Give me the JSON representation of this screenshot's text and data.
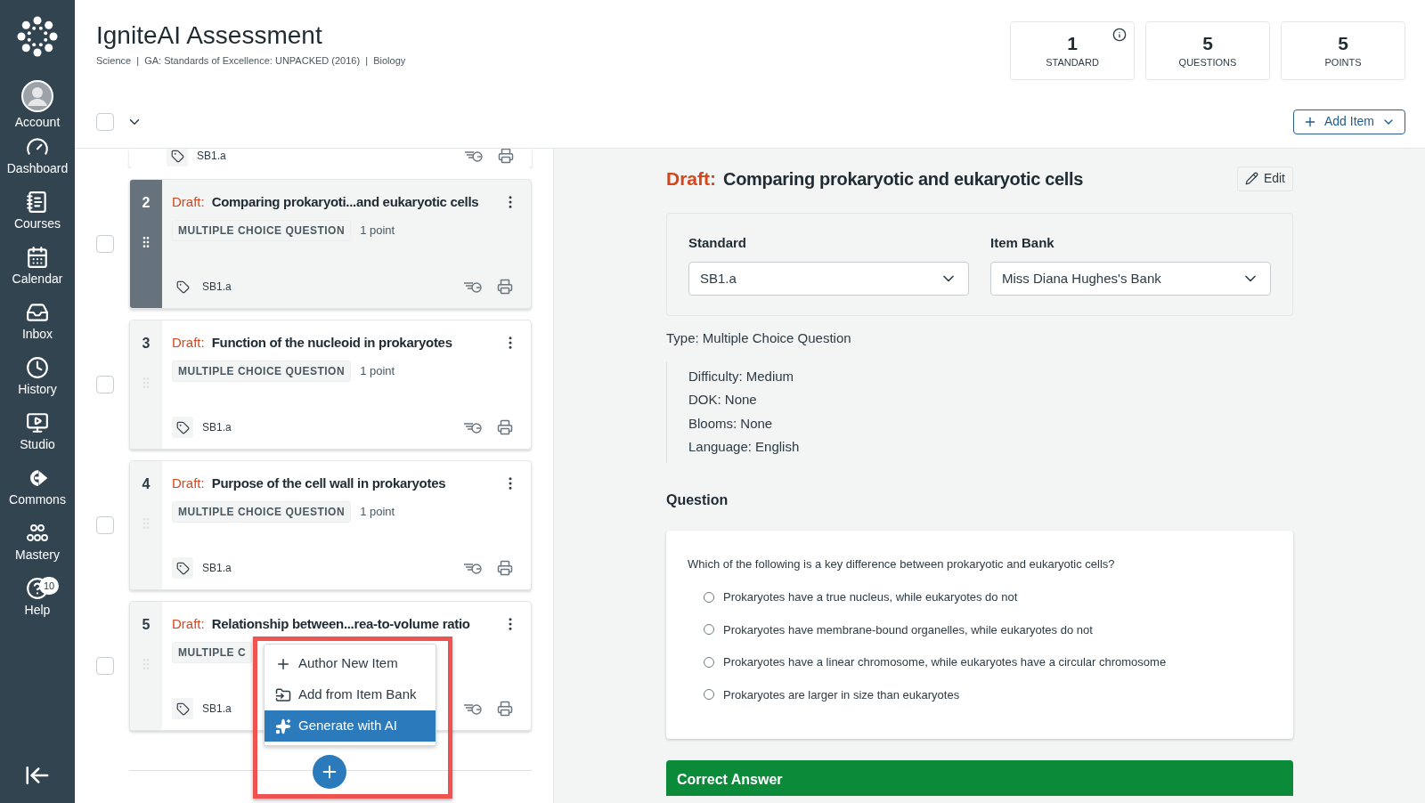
{
  "sidebar": {
    "items": [
      {
        "label": "Account"
      },
      {
        "label": "Dashboard"
      },
      {
        "label": "Courses"
      },
      {
        "label": "Calendar"
      },
      {
        "label": "Inbox"
      },
      {
        "label": "History"
      },
      {
        "label": "Studio"
      },
      {
        "label": "Commons"
      },
      {
        "label": "Mastery"
      },
      {
        "label": "Help",
        "badge": "10"
      }
    ]
  },
  "header": {
    "title": "IgniteAI Assessment",
    "breadcrumb": "Science  |  GA: Standards of Excellence: UNPACKED (2016)  |  Biology"
  },
  "stats": [
    {
      "value": "1",
      "label": "STANDARD",
      "info": true
    },
    {
      "value": "5",
      "label": "QUESTIONS",
      "info": false
    },
    {
      "value": "5",
      "label": "POINTS",
      "info": false
    }
  ],
  "toolbar": {
    "select_all_checked": false,
    "add_item": "Add Item"
  },
  "items": [
    {
      "kind": "partial",
      "selected": false,
      "standard": "SB1.a"
    },
    {
      "kind": "full",
      "number": "2",
      "checked": false,
      "selected": true,
      "status": "Draft:",
      "title": "Comparing prokaryoti...and eukaryotic cells",
      "type": "MULTIPLE CHOICE QUESTION",
      "points": "1 point",
      "standard": "SB1.a"
    },
    {
      "kind": "full",
      "number": "3",
      "checked": false,
      "selected": false,
      "status": "Draft:",
      "title": "Function of the nucleoid in prokaryotes",
      "type": "MULTIPLE CHOICE QUESTION",
      "points": "1 point",
      "standard": "SB1.a"
    },
    {
      "kind": "full",
      "number": "4",
      "checked": false,
      "selected": false,
      "status": "Draft:",
      "title": "Purpose of the cell wall in prokaryotes",
      "type": "MULTIPLE CHOICE QUESTION",
      "points": "1 point",
      "standard": "SB1.a"
    },
    {
      "kind": "full",
      "number": "5",
      "checked": false,
      "selected": false,
      "status": "Draft:",
      "title": "Relationship between...rea-to-volume ratio",
      "type": "MULTIPLE C",
      "standard": "SB1.a"
    }
  ],
  "add_menu": {
    "items": [
      {
        "label": "Author New Item",
        "highlighted": false
      },
      {
        "label": "Add from Item Bank",
        "highlighted": false
      },
      {
        "label": "Generate with AI",
        "highlighted": true
      }
    ]
  },
  "detail": {
    "status": "Draft:",
    "title": "Comparing prokaryotic and eukaryotic cells",
    "edit": "Edit",
    "standard_label": "Standard",
    "standard_value": "SB1.a",
    "bank_label": "Item Bank",
    "bank_value": "Miss Diana Hughes's Bank",
    "type": "Type: Multiple Choice Question",
    "meta": [
      "Difficulty: Medium",
      "DOK: None",
      "Blooms: None",
      "Language: English"
    ],
    "question_heading": "Question",
    "question": "Which of the following is a key difference between prokaryotic and eukaryotic cells?",
    "options": [
      {
        "label": "Prokaryotes have a true nucleus, while eukaryotes do not",
        "selected": false
      },
      {
        "label": "Prokaryotes have membrane-bound organelles, while eukaryotes do not",
        "selected": false
      },
      {
        "label": "Prokaryotes have a linear chromosome, while eukaryotes have a circular chromosome",
        "selected": false
      },
      {
        "label": "Prokaryotes are larger in size than eukaryotes",
        "selected": false
      }
    ],
    "correct_answer": "Correct Answer"
  }
}
